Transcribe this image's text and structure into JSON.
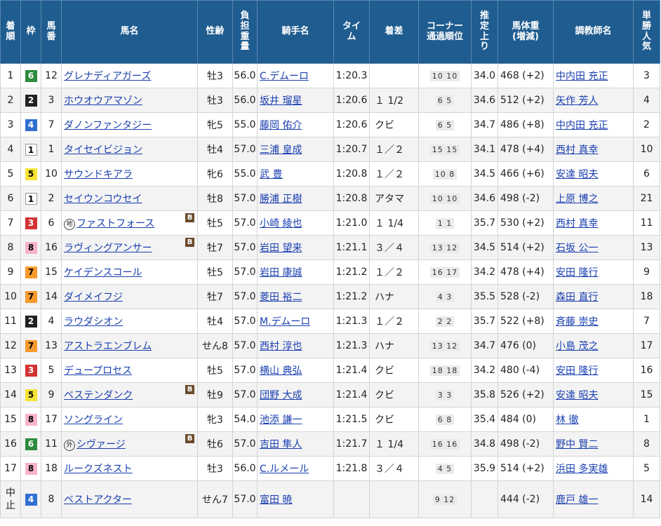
{
  "headers": {
    "rank": [
      "着",
      "順"
    ],
    "waku": "枠",
    "umaban": [
      "馬",
      "番"
    ],
    "name": "馬名",
    "sexage": "性齢",
    "weight": [
      "負",
      "担",
      "重",
      "量"
    ],
    "jockey": "騎手名",
    "time": [
      "タイ",
      "ム"
    ],
    "margin": "着差",
    "corner": [
      "コーナー",
      "通過順位"
    ],
    "last3f": [
      "推",
      "定",
      "上",
      "り"
    ],
    "bodyweight": [
      "馬体重",
      "(増減)"
    ],
    "trainer": "調教師名",
    "popularity": [
      "単",
      "勝",
      "人",
      "気"
    ]
  },
  "rows": [
    {
      "rank": "1",
      "waku": "6",
      "umaban": "12",
      "prefix": "",
      "name": "グレナディアガーズ",
      "blinker": "",
      "sexage": "牡3",
      "weight": "56.0",
      "jockey": "C.デムーロ",
      "time": "1:20.3",
      "margin": "",
      "corner": "10 10",
      "last3f": "34.0",
      "bodyweight": "468 (+2)",
      "trainer": "中内田 充正",
      "pop": "3"
    },
    {
      "rank": "2",
      "waku": "2",
      "umaban": "3",
      "prefix": "",
      "name": "ホウオウアマゾン",
      "blinker": "",
      "sexage": "牡3",
      "weight": "56.0",
      "jockey": "坂井 瑠星",
      "time": "1:20.6",
      "margin": "１ 1/2",
      "corner": "6 5",
      "last3f": "34.6",
      "bodyweight": "512 (+2)",
      "trainer": "矢作 芳人",
      "pop": "4"
    },
    {
      "rank": "3",
      "waku": "4",
      "umaban": "7",
      "prefix": "",
      "name": "ダノンファンタジー",
      "blinker": "",
      "sexage": "牝5",
      "weight": "55.0",
      "jockey": "藤岡 佑介",
      "time": "1:20.6",
      "margin": "クビ",
      "corner": "6 5",
      "last3f": "34.7",
      "bodyweight": "486 (+8)",
      "trainer": "中内田 充正",
      "pop": "2"
    },
    {
      "rank": "4",
      "waku": "1",
      "umaban": "1",
      "prefix": "",
      "name": "タイセイビジョン",
      "blinker": "",
      "sexage": "牡4",
      "weight": "57.0",
      "jockey": "三浦 皇成",
      "time": "1:20.7",
      "margin": "１／２",
      "corner": "15 15",
      "last3f": "34.1",
      "bodyweight": "478 (+4)",
      "trainer": "西村 真幸",
      "pop": "10"
    },
    {
      "rank": "5",
      "waku": "5",
      "umaban": "10",
      "prefix": "",
      "name": "サウンドキアラ",
      "blinker": "",
      "sexage": "牝6",
      "weight": "55.0",
      "jockey": "武 豊",
      "time": "1:20.8",
      "margin": "１／２",
      "corner": "10 8",
      "last3f": "34.5",
      "bodyweight": "466 (+6)",
      "trainer": "安達 昭夫",
      "pop": "6"
    },
    {
      "rank": "6",
      "waku": "1",
      "umaban": "2",
      "prefix": "",
      "name": "セイウンコウセイ",
      "blinker": "",
      "sexage": "牡8",
      "weight": "57.0",
      "jockey": "勝浦 正樹",
      "time": "1:20.8",
      "margin": "アタマ",
      "corner": "10 10",
      "last3f": "34.6",
      "bodyweight": "498 (-2)",
      "trainer": "上原 博之",
      "pop": "21"
    },
    {
      "rank": "7",
      "waku": "3",
      "umaban": "6",
      "prefix": "地",
      "name": "ファストフォース",
      "blinker": "B",
      "sexage": "牡5",
      "weight": "57.0",
      "jockey": "小崎 綾也",
      "time": "1:21.0",
      "margin": "１ 1/4",
      "corner": "1 1",
      "last3f": "35.7",
      "bodyweight": "530 (+2)",
      "trainer": "西村 真幸",
      "pop": "11"
    },
    {
      "rank": "8",
      "waku": "8",
      "umaban": "16",
      "prefix": "",
      "name": "ラヴィングアンサー",
      "blinker": "B",
      "sexage": "牡7",
      "weight": "57.0",
      "jockey": "岩田 望来",
      "time": "1:21.1",
      "margin": "３／４",
      "corner": "13 12",
      "last3f": "34.5",
      "bodyweight": "514 (+2)",
      "trainer": "石坂 公一",
      "pop": "13"
    },
    {
      "rank": "9",
      "waku": "7",
      "umaban": "15",
      "prefix": "",
      "name": "ケイデンスコール",
      "blinker": "",
      "sexage": "牡5",
      "weight": "57.0",
      "jockey": "岩田 康誠",
      "time": "1:21.2",
      "margin": "１／２",
      "corner": "16 17",
      "last3f": "34.2",
      "bodyweight": "478 (+4)",
      "trainer": "安田 隆行",
      "pop": "9"
    },
    {
      "rank": "10",
      "waku": "7",
      "umaban": "14",
      "prefix": "",
      "name": "ダイメイフジ",
      "blinker": "",
      "sexage": "牡7",
      "weight": "57.0",
      "jockey": "菱田 裕二",
      "time": "1:21.2",
      "margin": "ハナ",
      "corner": "4 3",
      "last3f": "35.5",
      "bodyweight": "528 (-2)",
      "trainer": "森田 直行",
      "pop": "18"
    },
    {
      "rank": "11",
      "waku": "2",
      "umaban": "4",
      "prefix": "",
      "name": "ラウダシオン",
      "blinker": "",
      "sexage": "牡4",
      "weight": "57.0",
      "jockey": "M.デムーロ",
      "time": "1:21.3",
      "margin": "１／２",
      "corner": "2 2",
      "last3f": "35.7",
      "bodyweight": "522 (+8)",
      "trainer": "斉藤 崇史",
      "pop": "7"
    },
    {
      "rank": "12",
      "waku": "7",
      "umaban": "13",
      "prefix": "",
      "name": "アストラエンブレム",
      "blinker": "",
      "sexage": "せん8",
      "weight": "57.0",
      "jockey": "西村 淳也",
      "time": "1:21.3",
      "margin": "ハナ",
      "corner": "13 12",
      "last3f": "34.7",
      "bodyweight": "476 (0)",
      "trainer": "小島 茂之",
      "pop": "17"
    },
    {
      "rank": "13",
      "waku": "3",
      "umaban": "5",
      "prefix": "",
      "name": "デュープロセス",
      "blinker": "",
      "sexage": "牡5",
      "weight": "57.0",
      "jockey": "横山 典弘",
      "time": "1:21.4",
      "margin": "クビ",
      "corner": "18 18",
      "last3f": "34.2",
      "bodyweight": "480 (-4)",
      "trainer": "安田 隆行",
      "pop": "16"
    },
    {
      "rank": "14",
      "waku": "5",
      "umaban": "9",
      "prefix": "",
      "name": "ベステンダンク",
      "blinker": "B",
      "sexage": "牡9",
      "weight": "57.0",
      "jockey": "団野 大成",
      "time": "1:21.4",
      "margin": "クビ",
      "corner": "3 3",
      "last3f": "35.8",
      "bodyweight": "526 (+2)",
      "trainer": "安達 昭夫",
      "pop": "15"
    },
    {
      "rank": "15",
      "waku": "8",
      "umaban": "17",
      "prefix": "",
      "name": "ソングライン",
      "blinker": "",
      "sexage": "牝3",
      "weight": "54.0",
      "jockey": "池添 謙一",
      "time": "1:21.5",
      "margin": "クビ",
      "corner": "6 8",
      "last3f": "35.4",
      "bodyweight": "484 (0)",
      "trainer": "林 徹",
      "pop": "1"
    },
    {
      "rank": "16",
      "waku": "6",
      "umaban": "11",
      "prefix": "外",
      "name": "シヴァージ",
      "blinker": "B",
      "sexage": "牡6",
      "weight": "57.0",
      "jockey": "吉田 隼人",
      "time": "1:21.7",
      "margin": "１ 1/4",
      "corner": "16 16",
      "last3f": "34.8",
      "bodyweight": "498 (-2)",
      "trainer": "野中 賢二",
      "pop": "8"
    },
    {
      "rank": "17",
      "waku": "8",
      "umaban": "18",
      "prefix": "",
      "name": "ルークズネスト",
      "blinker": "",
      "sexage": "牡3",
      "weight": "56.0",
      "jockey": "C.ルメール",
      "time": "1:21.8",
      "margin": "３／４",
      "corner": "4 5",
      "last3f": "35.9",
      "bodyweight": "514 (+2)",
      "trainer": "浜田 多実雄",
      "pop": "5"
    },
    {
      "rank": "中止",
      "waku": "4",
      "umaban": "8",
      "prefix": "",
      "name": "ベストアクター",
      "blinker": "",
      "sexage": "せん7",
      "weight": "57.0",
      "jockey": "富田 暁",
      "time": "",
      "margin": "",
      "corner": "9 12",
      "last3f": "",
      "bodyweight": "444 (-2)",
      "trainer": "鹿戸 雄一",
      "pop": "14"
    }
  ]
}
